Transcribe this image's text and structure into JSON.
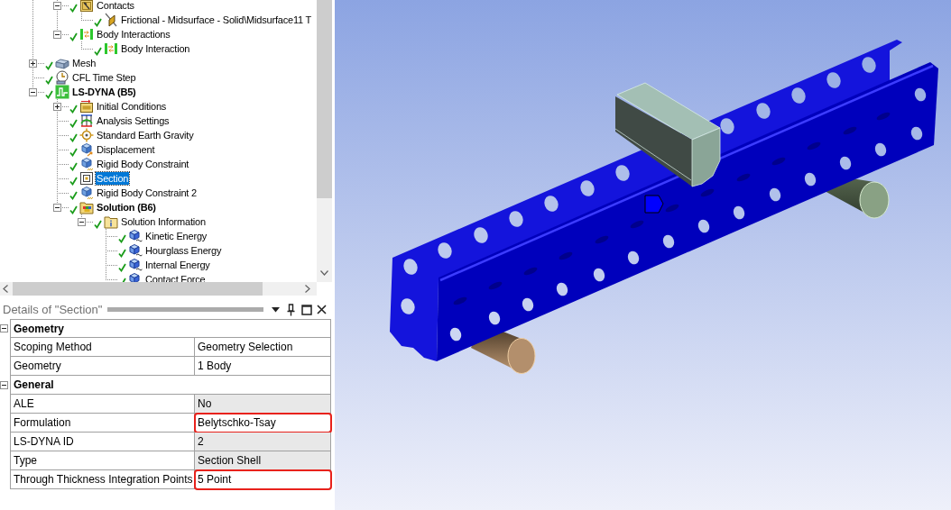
{
  "tree": {
    "items": [
      {
        "children": [
          {
            "label": "Contacts",
            "kind": "contacts",
            "expanded": true,
            "checked": true,
            "selected": false,
            "children": [
              {
                "label": "Frictional - Midsurface - Solid\\Midsurface11 T",
                "kind": "contact",
                "checked": true,
                "selected": false
              }
            ]
          },
          {
            "label": "Body Interactions",
            "kind": "interactions",
            "expanded": true,
            "checked": true,
            "selected": false,
            "children": [
              {
                "label": "Body Interaction",
                "kind": "interaction",
                "checked": true,
                "selected": false
              }
            ]
          }
        ]
      },
      {
        "label": "Mesh",
        "kind": "mesh",
        "expanded": false,
        "checked": true,
        "selected": false
      },
      {
        "label": "CFL Time Step",
        "kind": "time_step",
        "checked": true,
        "selected": false
      },
      {
        "label": "LS-DYNA (B5)",
        "kind": "analysis",
        "expanded": true,
        "checked": true,
        "selected": false,
        "children": [
          {
            "label": "Initial Conditions",
            "kind": "initial",
            "expanded": false,
            "checked": true,
            "selected": false
          },
          {
            "label": "Analysis Settings",
            "kind": "settings",
            "checked": true,
            "selected": false
          },
          {
            "label": "Standard Earth Gravity",
            "kind": "gravity",
            "checked": true,
            "selected": false
          },
          {
            "label": "Displacement",
            "kind": "load",
            "checked": true,
            "selected": false
          },
          {
            "label": "Rigid Body Constraint",
            "kind": "constraint",
            "checked": true,
            "selected": false
          },
          {
            "label": "Section",
            "kind": "section",
            "checked": true,
            "selected": true
          },
          {
            "label": "Rigid Body Constraint 2",
            "kind": "constraint",
            "checked": true,
            "selected": false
          },
          {
            "label": "Solution (B6)",
            "kind": "solution",
            "expanded": true,
            "checked": true,
            "selected": false,
            "children": [
              {
                "label": "Solution Information",
                "kind": "info",
                "expanded": true,
                "checked": true,
                "selected": false,
                "children": [
                  {
                    "label": "Kinetic Energy",
                    "kind": "result",
                    "checked": true,
                    "selected": false
                  },
                  {
                    "label": "Hourglass Energy",
                    "kind": "result",
                    "checked": true,
                    "selected": false
                  },
                  {
                    "label": "Internal Energy",
                    "kind": "result",
                    "checked": true,
                    "selected": false
                  },
                  {
                    "label": "Contact Force",
                    "kind": "result",
                    "checked": true,
                    "selected": false
                  }
                ]
              }
            ]
          }
        ]
      }
    ]
  },
  "details": {
    "title": "Details of \"Section\"",
    "groups": [
      {
        "label": "Geometry",
        "expanded": true,
        "rows": [
          {
            "label": "Scoping Method",
            "value": "Geometry Selection",
            "read_only": false,
            "highlighted": false
          },
          {
            "label": "Geometry",
            "value": "1 Body",
            "read_only": false,
            "highlighted": false
          }
        ]
      },
      {
        "label": "General",
        "expanded": true,
        "rows": [
          {
            "label": "ALE",
            "value": "No",
            "read_only": true,
            "highlighted": false
          },
          {
            "label": "Formulation",
            "value": "Belytschko-Tsay",
            "read_only": false,
            "highlighted": true
          },
          {
            "label": "LS-DYNA ID",
            "value": "2",
            "read_only": true,
            "highlighted": false
          },
          {
            "label": "Type",
            "value": "Section Shell",
            "read_only": true,
            "highlighted": false
          },
          {
            "label": "Through Thickness Integration Points",
            "value": "5 Point",
            "read_only": false,
            "highlighted": true
          }
        ]
      }
    ]
  }
}
